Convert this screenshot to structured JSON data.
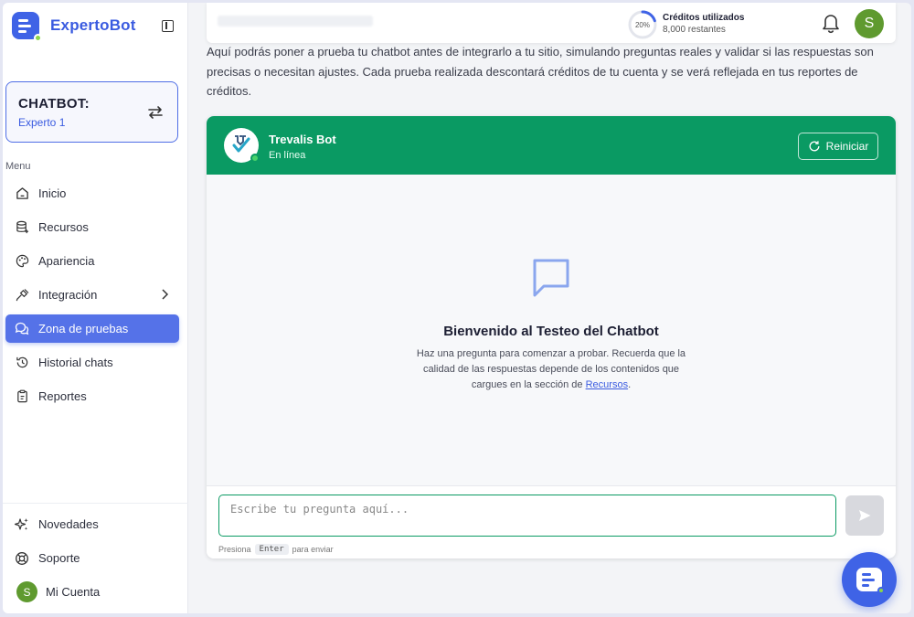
{
  "brand": {
    "name": "ExpertoBot"
  },
  "chatbot_card": {
    "title": "CHATBOT:",
    "subtitle": "Experto 1"
  },
  "sidebar": {
    "menu_label": "Menu",
    "items": [
      {
        "label": "Inicio",
        "icon": "home-icon"
      },
      {
        "label": "Recursos",
        "icon": "database-icon"
      },
      {
        "label": "Apariencia",
        "icon": "palette-icon"
      },
      {
        "label": "Integración",
        "icon": "plug-icon"
      },
      {
        "label": "Zona de pruebas",
        "icon": "chat-bubbles-icon",
        "active": true
      },
      {
        "label": "Historial chats",
        "icon": "history-icon"
      },
      {
        "label": "Reportes",
        "icon": "clipboard-icon"
      }
    ],
    "bottom_items": [
      {
        "label": "Novedades",
        "icon": "sparkles-icon"
      },
      {
        "label": "Soporte",
        "icon": "lifebuoy-icon"
      },
      {
        "label": "Mi Cuenta",
        "icon": "avatar",
        "avatar_letter": "S"
      }
    ]
  },
  "topbar": {
    "credits_percent_label": "20%",
    "credits_fraction": 0.2,
    "credits_title": "Créditos utilizados",
    "credits_remaining": "8,000 restantes",
    "avatar_letter": "S",
    "avatar_color": "#5f9a2f"
  },
  "intro": {
    "text": "Aquí podrás poner a prueba tu chatbot antes de integrarlo a tu sitio, simulando preguntas reales y validar si las respuestas son precisas o necesitan ajustes. Cada prueba realizada descontará créditos de tu cuenta y se verá reflejada en tus reportes de créditos."
  },
  "chat": {
    "header_color": "#0a9a63",
    "bot_name": "Trevalis Bot",
    "bot_status": "En línea",
    "reset_label": "Reiniciar",
    "welcome_title": "Bienvenido al Testeo del Chatbot",
    "welcome_text_before": "Haz una pregunta para comenzar a probar. Recuerda que la calidad de las respuestas depende de los contenidos que cargues en la sección de ",
    "welcome_link": "Recursos",
    "welcome_text_after": ".",
    "input_placeholder": "Escribe tu pregunta aquí...",
    "hint_before": "Presiona",
    "hint_key": "Enter",
    "hint_after": "para enviar"
  },
  "colors": {
    "accent": "#3f63e6",
    "brand_green": "#0a9a63",
    "active_nav": "#5572e8"
  }
}
